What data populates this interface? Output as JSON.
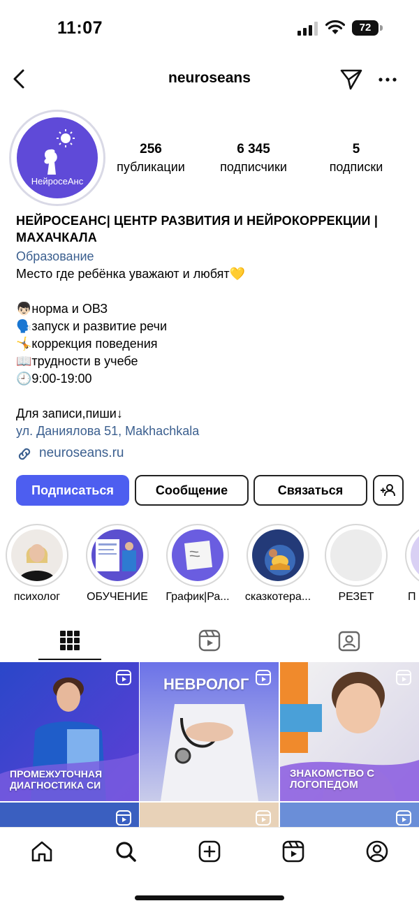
{
  "status": {
    "time": "11:07",
    "battery": "72"
  },
  "nav": {
    "username": "neuroseans",
    "back_icon": "chevron-left-icon",
    "send_icon": "paper-plane-icon",
    "more_icon": "more-dots-icon",
    "more_label": "···"
  },
  "profile": {
    "avatar_text": "НейросеАнс",
    "stats": [
      {
        "value": "256",
        "label": "публикации"
      },
      {
        "value": "6 345",
        "label": "подписчики"
      },
      {
        "value": "5",
        "label": "подписки"
      }
    ]
  },
  "bio": {
    "title": "НЕЙРОСЕАНС| ЦЕНТР РАЗВИТИЯ И НЕЙРОКОРРЕКЦИИ | МАХАЧКАЛА",
    "category": "Образование",
    "tagline": "Место где ребёнка уважают и любят💛",
    "lines": [
      "👦🏻норма и ОВЗ",
      "🗣️запуск и развитие речи",
      "🤸коррекция поведения",
      "📖трудности в учебе",
      "🕘9:00-19:00"
    ],
    "contact_note": "Для записи,пиши↓",
    "address": "ул. Даниялова 51, Makhachkala",
    "link": "neuroseans.ru"
  },
  "buttons": {
    "follow": "Подписаться",
    "message": "Сообщение",
    "contact": "Связаться",
    "add_user_icon": "add-person-icon"
  },
  "highlights": [
    {
      "label": "психолог"
    },
    {
      "label": "ОБУЧЕНИЕ"
    },
    {
      "label": "График|Ра..."
    },
    {
      "label": "сказкотера..."
    },
    {
      "label": "РЕЗЕТ"
    },
    {
      "label": "П"
    }
  ],
  "tabs": [
    {
      "icon": "grid-icon",
      "active": true
    },
    {
      "icon": "reels-icon",
      "active": false
    },
    {
      "icon": "tagged-icon",
      "active": false
    }
  ],
  "posts": [
    {
      "caption": "ПРОМЕЖУТОЧНАЯ\nДИАГНОСТИКА СИ",
      "badge": "reel-icon"
    },
    {
      "caption": "НЕВРОЛОГ",
      "badge": "reel-icon"
    },
    {
      "caption": "ЗНАКОМСТВО С\nЛОГОПЕДОМ",
      "badge": "reel-icon"
    }
  ],
  "bottom_nav": [
    "home-icon",
    "search-icon",
    "create-icon",
    "reels-icon",
    "profile-icon"
  ],
  "colors": {
    "accent": "#4d5ef0",
    "link": "#3b5f8f",
    "brand_purple": "#5f4ad8"
  }
}
